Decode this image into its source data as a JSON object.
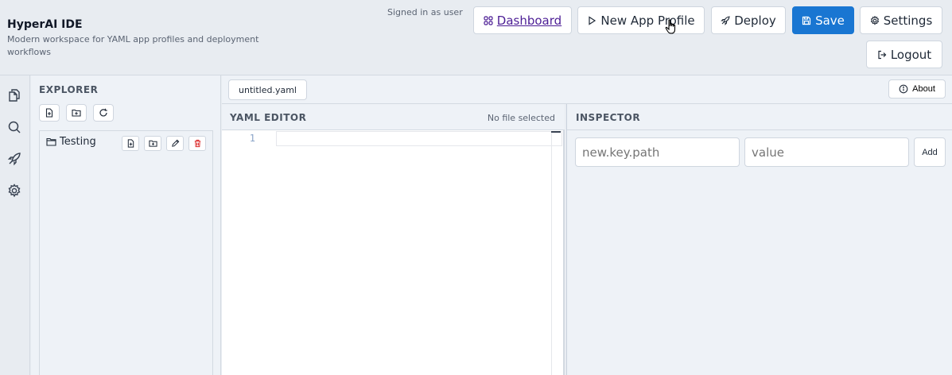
{
  "header": {
    "title": "HyperAI IDE",
    "subtitle": "Modern workspace for YAML app profiles and deployment workflows",
    "signed_in": "Signed in as user",
    "buttons": {
      "dashboard": "Dashboard",
      "new_app_profile": "New App Profile",
      "deploy": "Deploy",
      "save": "Save",
      "settings": "Settings",
      "logout": "Logout"
    }
  },
  "explorer": {
    "title": "EXPLORER",
    "items": [
      {
        "label": "Testing",
        "type": "folder"
      }
    ]
  },
  "tabs": {
    "active": "untitled.yaml",
    "about": "About"
  },
  "editor": {
    "title": "YAML EDITOR",
    "status": "No file selected",
    "line_numbers": [
      "1"
    ]
  },
  "inspector": {
    "title": "INSPECTOR",
    "key_placeholder": "new.key.path",
    "value_placeholder": "value",
    "add_label": "Add"
  },
  "colors": {
    "accent": "#1976d2",
    "dashboard_link": "#4c1d95",
    "delete": "#dc2626"
  }
}
